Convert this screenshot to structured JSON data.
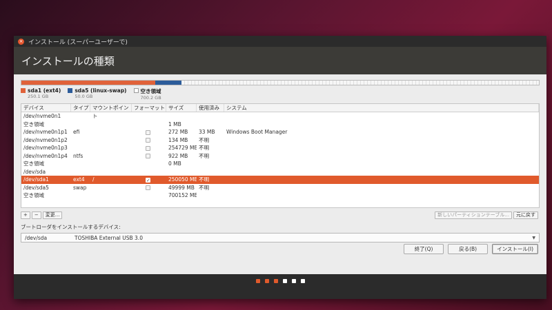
{
  "window": {
    "title": "インストール (スーパーユーザーで)",
    "heading": "インストールの種類"
  },
  "usage_bar": {
    "ext4_color": "#e0623a",
    "swap_color": "#2c5c9a"
  },
  "legend": [
    {
      "name": "sda1 (ext4)",
      "size": "250.1 GB",
      "color": "#e0623a"
    },
    {
      "name": "sda5 (linux-swap)",
      "size": "50.0 GB",
      "color": "#2c5c9a"
    },
    {
      "name": "空き領域",
      "size": "700.2 GB",
      "color": "#ffffff"
    }
  ],
  "table": {
    "headers": [
      "デバイス",
      "タイプ",
      "マウントポイント",
      "フォーマット",
      "サイズ",
      "使用済み",
      "システム"
    ],
    "rows": [
      {
        "device": "/dev/nvme0n1",
        "group": true
      },
      {
        "device": "空き領域",
        "type": "",
        "mount": "",
        "size": "1 MB",
        "used": "",
        "system": "",
        "format": false
      },
      {
        "device": "/dev/nvme0n1p1",
        "type": "efi",
        "mount": "",
        "size": "272 MB",
        "used": "33 MB",
        "system": "Windows Boot Manager",
        "format": true
      },
      {
        "device": "/dev/nvme0n1p2",
        "type": "",
        "mount": "",
        "size": "134 MB",
        "used": "不明",
        "system": "",
        "format": true
      },
      {
        "device": "/dev/nvme0n1p3",
        "type": "",
        "mount": "",
        "size": "254729 MB",
        "used": "不明",
        "system": "",
        "format": true
      },
      {
        "device": "/dev/nvme0n1p4",
        "type": "ntfs",
        "mount": "",
        "size": "922 MB",
        "used": "不明",
        "system": "",
        "format": true
      },
      {
        "device": "空き領域",
        "type": "",
        "mount": "",
        "size": "0 MB",
        "used": "",
        "system": "",
        "format": false
      },
      {
        "device": "/dev/sda",
        "group": true
      },
      {
        "device": "/dev/sda1",
        "type": "ext4",
        "mount": "/",
        "size": "250050 MB",
        "used": "不明",
        "system": "",
        "format": true,
        "selected": true
      },
      {
        "device": "/dev/sda5",
        "type": "swap",
        "mount": "",
        "size": "49999 MB",
        "used": "不明",
        "system": "",
        "format": true
      },
      {
        "device": "空き領域",
        "type": "",
        "mount": "",
        "size": "700152 MB",
        "used": "",
        "system": "",
        "format": false
      }
    ]
  },
  "toolbar": {
    "add": "+",
    "remove": "−",
    "change": "変更...",
    "new_table": "新しいパーティションテーブル...",
    "revert": "元に戻す"
  },
  "bootloader": {
    "label": "ブートローダをインストールするデバイス:",
    "device": "/dev/sda",
    "description": "TOSHIBA External USB 3.0"
  },
  "actions": {
    "quit": "終了(Q)",
    "back": "戻る(B)",
    "install": "インストール(I)"
  },
  "progress_dots": {
    "total": 6,
    "active": 3
  }
}
